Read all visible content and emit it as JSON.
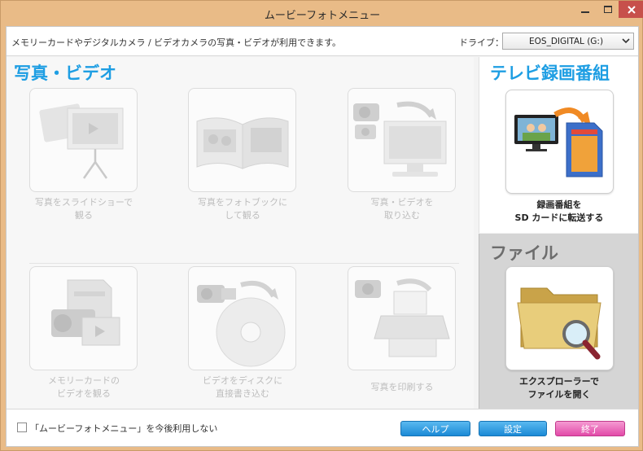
{
  "window": {
    "title": "ムービーフォトメニュー",
    "min_icon": "minimize-icon",
    "max_icon": "maximize-icon",
    "close_icon": "close-icon"
  },
  "infobar": {
    "message": "メモリーカードやデジタルカメラ / ビデオカメラの写真・ビデオが利用できます。",
    "drive_label": "ドライブ：",
    "drive_value": "EOS_DIGITAL (G:)"
  },
  "photo_video": {
    "title": "写真・ビデオ",
    "tiles": [
      {
        "label1": "写真をスライドショーで",
        "label2": "観る",
        "icon": "slideshow-icon"
      },
      {
        "label1": "写真をフォトブックに",
        "label2": "して観る",
        "icon": "photobook-icon"
      },
      {
        "label1": "写真・ビデオを",
        "label2": "取り込む",
        "icon": "import-icon"
      },
      {
        "label1": "メモリーカードの",
        "label2": "ビデオを観る",
        "icon": "memory-card-video-icon"
      },
      {
        "label1": "ビデオをディスクに",
        "label2": "直接書き込む",
        "icon": "disc-write-icon"
      },
      {
        "label1": "写真を印刷する",
        "label2": "",
        "icon": "printer-icon"
      }
    ]
  },
  "tv": {
    "title": "テレビ録画番組",
    "label1": "録画番組を",
    "label2": "SD カードに転送する",
    "icon": "sd-transfer-icon"
  },
  "file": {
    "title": "ファイル",
    "label1": "エクスプローラーで",
    "label2": "ファイルを開く",
    "icon": "folder-search-icon"
  },
  "bottom": {
    "checkbox_label": "「ムービーフォトメニュー」を今後利用しない",
    "help": "ヘルプ",
    "settings": "設定",
    "quit": "終了"
  },
  "colors": {
    "accent_blue": "#1e9ee3",
    "window_tan": "#e9bb87",
    "quit_pink": "#e24aa8"
  }
}
